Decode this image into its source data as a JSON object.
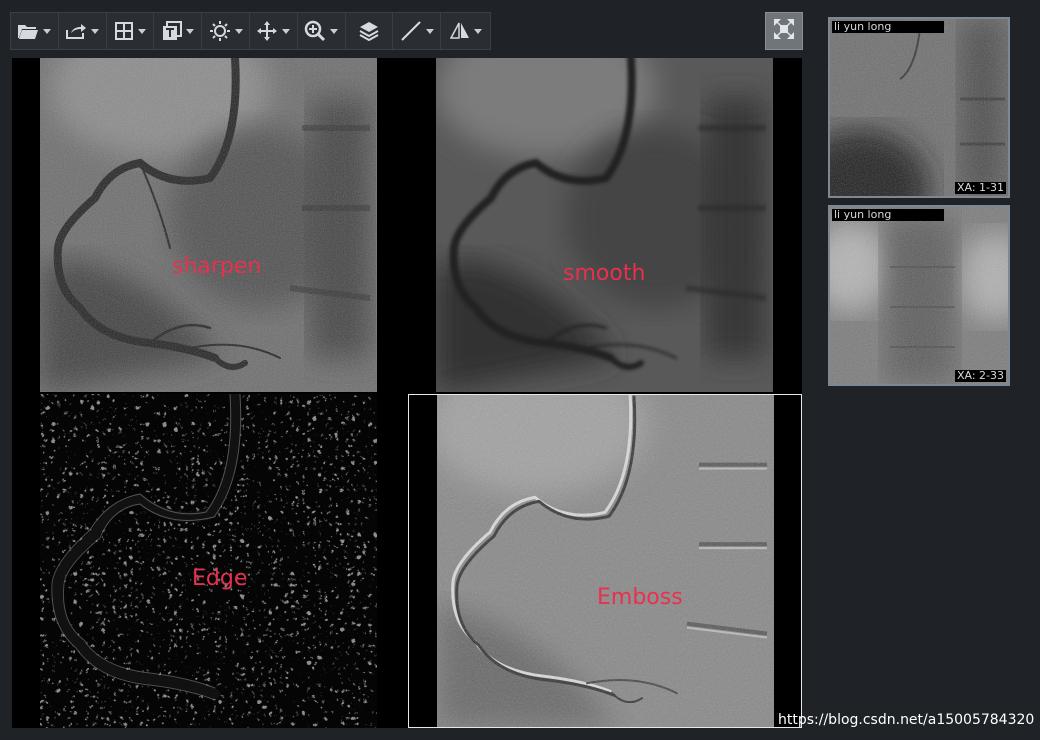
{
  "toolbar": {
    "tools": [
      {
        "icon": "folder-open-icon",
        "has_dropdown": true
      },
      {
        "icon": "export-icon",
        "has_dropdown": true
      },
      {
        "icon": "layout-grid-icon",
        "has_dropdown": true
      },
      {
        "icon": "text-overlay-icon",
        "has_dropdown": true
      },
      {
        "icon": "brightness-icon",
        "has_dropdown": true
      },
      {
        "icon": "pan-move-icon",
        "has_dropdown": true
      },
      {
        "icon": "zoom-in-icon",
        "has_dropdown": true
      },
      {
        "icon": "layers-icon",
        "has_dropdown": false
      },
      {
        "icon": "line-measure-icon",
        "has_dropdown": true
      },
      {
        "icon": "flip-icon",
        "has_dropdown": true
      }
    ],
    "fullscreen_icon": "fullscreen-icon"
  },
  "viewports": [
    {
      "label": "sharpen",
      "filter": "sharpen"
    },
    {
      "label": "smooth",
      "filter": "smooth"
    },
    {
      "label": "Edge",
      "filter": "edge"
    },
    {
      "label": "Emboss",
      "filter": "emboss",
      "active": true
    }
  ],
  "thumbnails": [
    {
      "patient": "li yun long",
      "series": "XA: 1-31"
    },
    {
      "patient": "li yun long",
      "series": "XA: 2-33"
    }
  ],
  "watermark": "https://blog.csdn.net/a15005784320",
  "colors": {
    "background": "#1f2226",
    "label": "#e8304f",
    "toolbar_bg": "#2a2e33"
  }
}
